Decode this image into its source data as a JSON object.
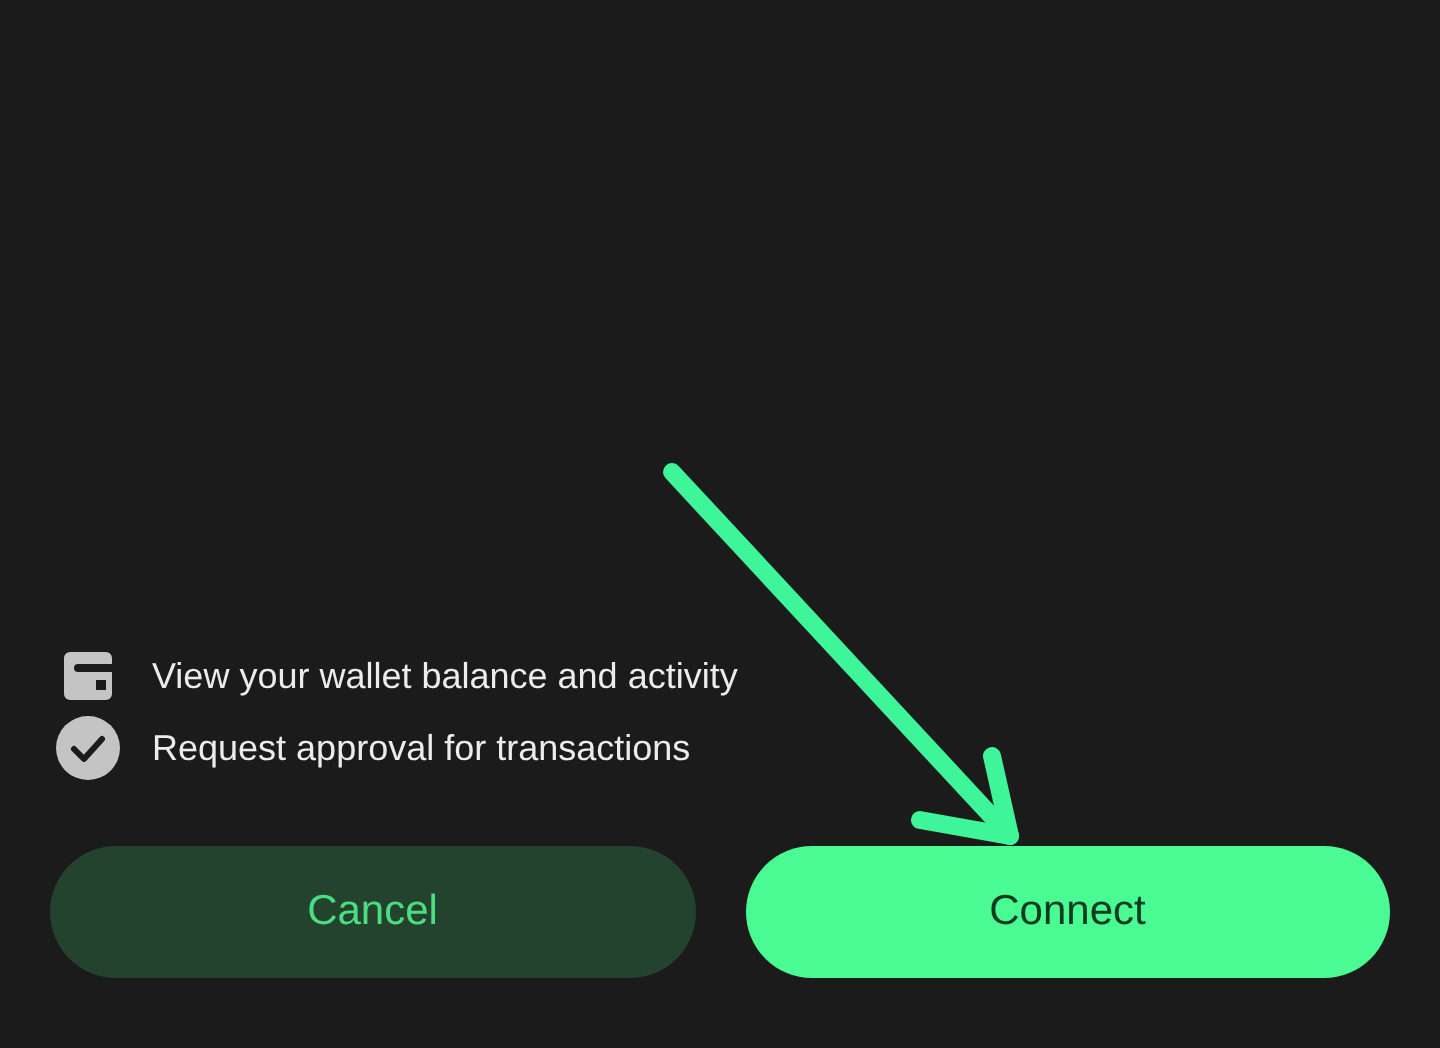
{
  "permissions": [
    {
      "kind": "wallet",
      "label": "View your wallet balance and activity"
    },
    {
      "kind": "check",
      "label": "Request approval for transactions"
    }
  ],
  "buttons": [
    {
      "kind": "secondary",
      "label": "Cancel"
    },
    {
      "kind": "primary",
      "label": "Connect"
    }
  ]
}
